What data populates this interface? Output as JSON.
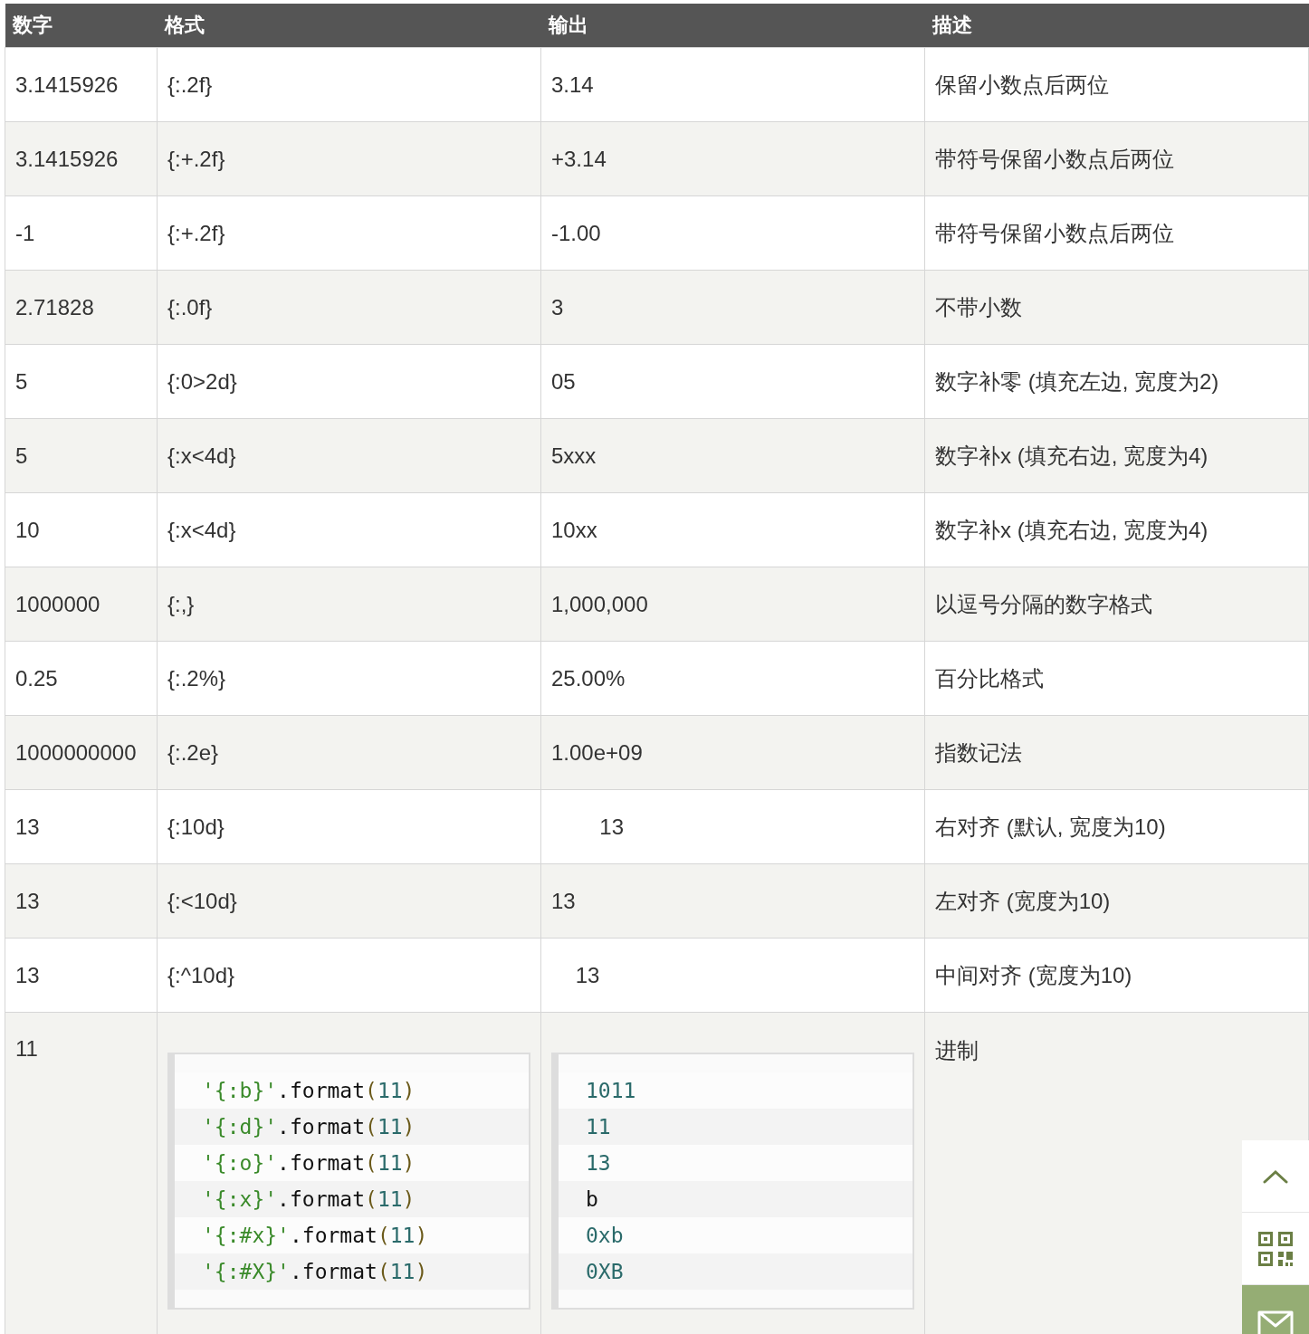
{
  "table": {
    "columns": [
      "数字",
      "格式",
      "输出",
      "描述"
    ],
    "rows": [
      {
        "kind": "text",
        "cells": [
          "3.1415926",
          "{:.2f}",
          "3.14",
          "保留小数点后两位"
        ]
      },
      {
        "kind": "text",
        "cells": [
          "3.1415926",
          "{:+.2f}",
          "+3.14",
          "带符号保留小数点后两位"
        ]
      },
      {
        "kind": "text",
        "cells": [
          "-1",
          "{:+.2f}",
          "-1.00",
          "带符号保留小数点后两位"
        ]
      },
      {
        "kind": "text",
        "cells": [
          "2.71828",
          "{:.0f}",
          "3",
          "不带小数"
        ]
      },
      {
        "kind": "text",
        "cells": [
          "5",
          "{:0>2d}",
          "05",
          "数字补零 (填充左边, 宽度为2)"
        ]
      },
      {
        "kind": "text",
        "cells": [
          "5",
          "{:x<4d}",
          "5xxx",
          "数字补x (填充右边, 宽度为4)"
        ]
      },
      {
        "kind": "text",
        "cells": [
          "10",
          "{:x<4d}",
          "10xx",
          "数字补x (填充右边, 宽度为4)"
        ]
      },
      {
        "kind": "text",
        "cells": [
          "1000000",
          "{:,}",
          "1,000,000",
          "以逗号分隔的数字格式"
        ]
      },
      {
        "kind": "text",
        "cells": [
          "0.25",
          "{:.2%}",
          "25.00%",
          "百分比格式"
        ]
      },
      {
        "kind": "text",
        "cells": [
          "1000000000",
          "{:.2e}",
          "1.00e+09",
          "指数记法"
        ]
      },
      {
        "kind": "text",
        "cells": [
          "13",
          "{:10d}",
          "        13",
          "右对齐 (默认, 宽度为10)"
        ]
      },
      {
        "kind": "text",
        "cells": [
          "13",
          "{:<10d}",
          "13",
          "左对齐 (宽度为10)"
        ]
      },
      {
        "kind": "text",
        "cells": [
          "13",
          "{:^10d}",
          "    13",
          "中间对齐 (宽度为10)"
        ]
      },
      {
        "kind": "code",
        "number": "11",
        "description": "进制",
        "format_lines": [
          [
            {
              "text": "'{:b}'",
              "kind": "string"
            },
            {
              "text": ".format",
              "kind": "plain"
            },
            {
              "text": "(",
              "kind": "paren"
            },
            {
              "text": "11",
              "kind": "number"
            },
            {
              "text": ")",
              "kind": "paren"
            }
          ],
          [
            {
              "text": "'{:d}'",
              "kind": "string"
            },
            {
              "text": ".format",
              "kind": "plain"
            },
            {
              "text": "(",
              "kind": "paren"
            },
            {
              "text": "11",
              "kind": "number"
            },
            {
              "text": ")",
              "kind": "paren"
            }
          ],
          [
            {
              "text": "'{:o}'",
              "kind": "string"
            },
            {
              "text": ".format",
              "kind": "plain"
            },
            {
              "text": "(",
              "kind": "paren"
            },
            {
              "text": "11",
              "kind": "number"
            },
            {
              "text": ")",
              "kind": "paren"
            }
          ],
          [
            {
              "text": "'{:x}'",
              "kind": "string"
            },
            {
              "text": ".format",
              "kind": "plain"
            },
            {
              "text": "(",
              "kind": "paren"
            },
            {
              "text": "11",
              "kind": "number"
            },
            {
              "text": ")",
              "kind": "paren"
            }
          ],
          [
            {
              "text": "'{:#x}'",
              "kind": "string"
            },
            {
              "text": ".format",
              "kind": "plain"
            },
            {
              "text": "(",
              "kind": "paren"
            },
            {
              "text": "11",
              "kind": "number"
            },
            {
              "text": ")",
              "kind": "paren"
            }
          ],
          [
            {
              "text": "'{:#X}'",
              "kind": "string"
            },
            {
              "text": ".format",
              "kind": "plain"
            },
            {
              "text": "(",
              "kind": "paren"
            },
            {
              "text": "11",
              "kind": "number"
            },
            {
              "text": ")",
              "kind": "paren"
            }
          ]
        ],
        "output_lines": [
          [
            {
              "text": "1011",
              "kind": "number"
            }
          ],
          [
            {
              "text": "11",
              "kind": "number"
            }
          ],
          [
            {
              "text": "13",
              "kind": "number"
            }
          ],
          [
            {
              "text": "b",
              "kind": "plain"
            }
          ],
          [
            {
              "text": "0xb",
              "kind": "number"
            }
          ],
          [
            {
              "text": "0XB",
              "kind": "number"
            }
          ]
        ]
      }
    ]
  }
}
